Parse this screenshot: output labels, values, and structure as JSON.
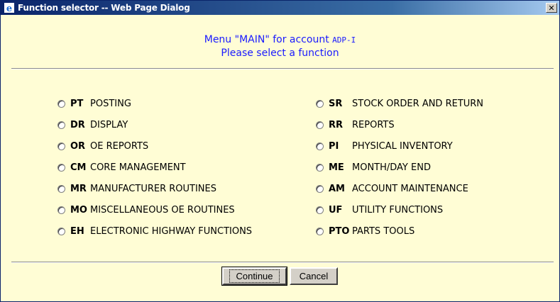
{
  "window": {
    "title": "Function selector -- Web Page Dialog",
    "close_label": "✕"
  },
  "header": {
    "menu_prefix": "Menu \"MAIN\" for account ",
    "account": "ADP-I",
    "subtitle": "Please select a function"
  },
  "left_options": [
    {
      "code": "PT",
      "label": "POSTING"
    },
    {
      "code": "DR",
      "label": "DISPLAY"
    },
    {
      "code": "OR",
      "label": "OE REPORTS"
    },
    {
      "code": "CM",
      "label": "CORE MANAGEMENT"
    },
    {
      "code": "MR",
      "label": "MANUFACTURER ROUTINES"
    },
    {
      "code": "MO",
      "label": "MISCELLANEOUS OE ROUTINES"
    },
    {
      "code": "EH",
      "label": "ELECTRONIC HIGHWAY FUNCTIONS"
    }
  ],
  "right_options": [
    {
      "code": "SR",
      "label": "STOCK ORDER AND RETURN"
    },
    {
      "code": "RR",
      "label": "REPORTS"
    },
    {
      "code": "PI",
      "label": "PHYSICAL INVENTORY"
    },
    {
      "code": "ME",
      "label": "MONTH/DAY END"
    },
    {
      "code": "AM",
      "label": "ACCOUNT MAINTENANCE"
    },
    {
      "code": "UF",
      "label": "UTILITY FUNCTIONS"
    },
    {
      "code": "PTO",
      "label": "PARTS TOOLS"
    }
  ],
  "buttons": {
    "continue": "Continue",
    "cancel": "Cancel"
  },
  "colors": {
    "background": "#fffdd5",
    "heading": "#1a1aff",
    "titlebar_start": "#0a246a",
    "titlebar_end": "#a6caf0"
  }
}
